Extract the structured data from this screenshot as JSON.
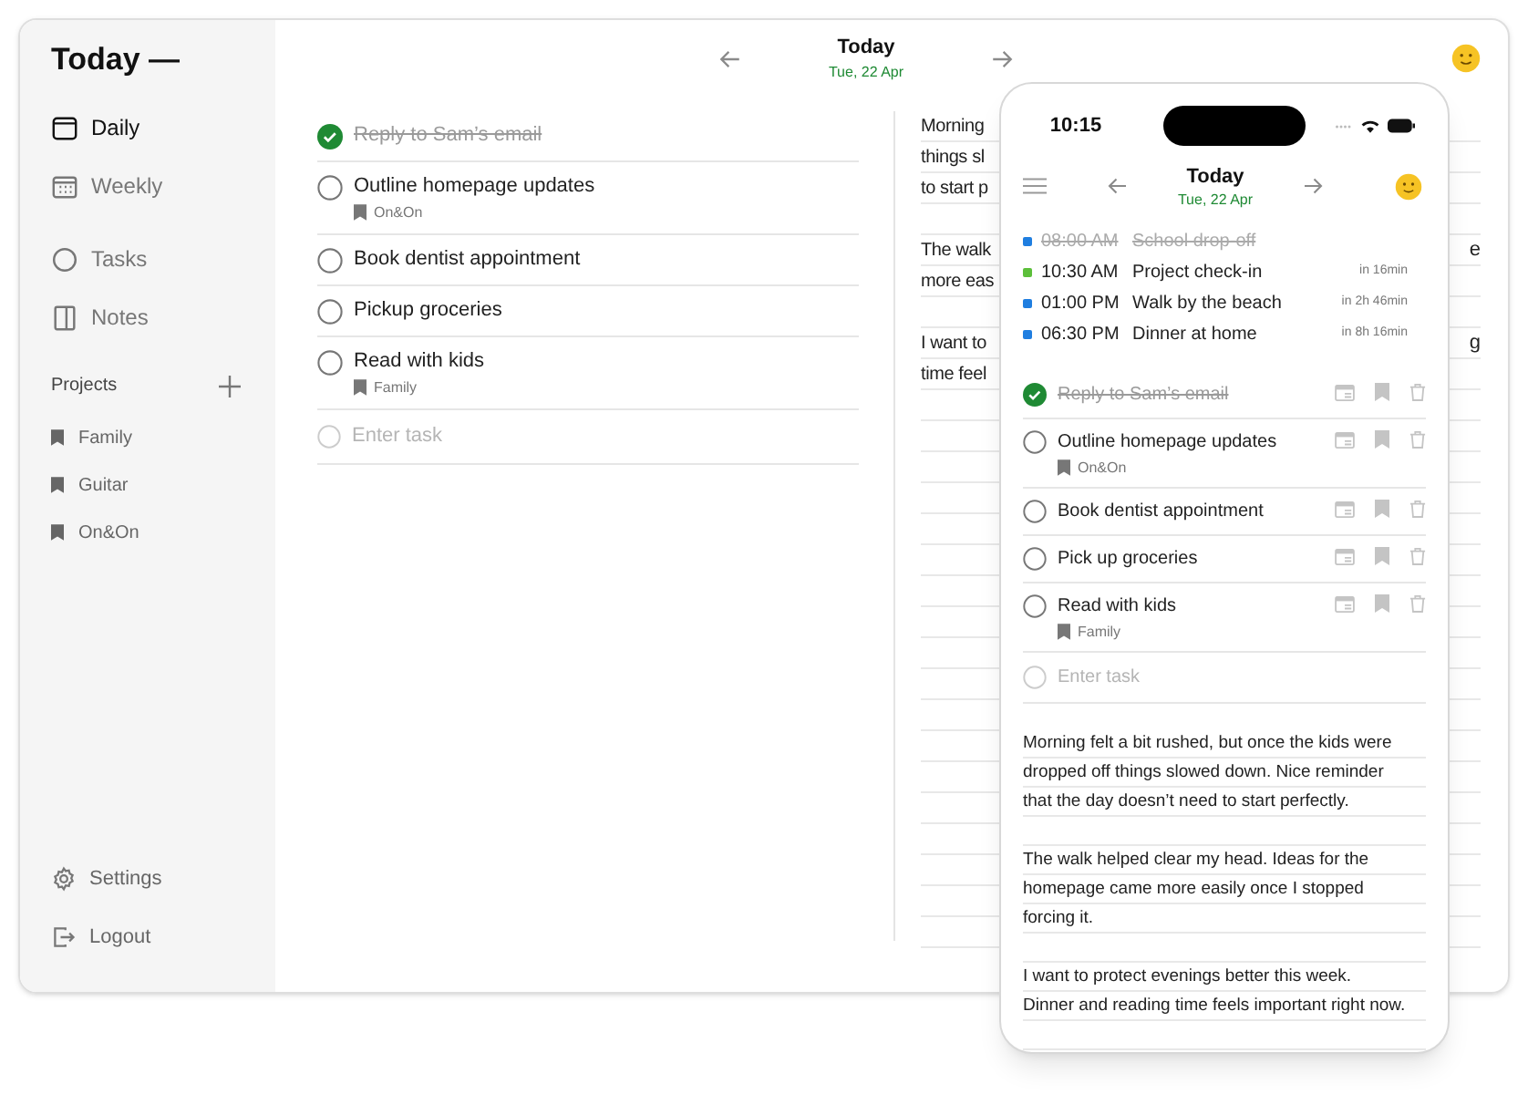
{
  "sidebar": {
    "title": "Today —",
    "nav": [
      {
        "label": "Daily",
        "kind": "daily",
        "selected": true
      },
      {
        "label": "Weekly",
        "kind": "weekly",
        "selected": false
      },
      {
        "label": "Tasks",
        "kind": "tasks",
        "selected": false
      },
      {
        "label": "Notes",
        "kind": "notes",
        "selected": false
      }
    ],
    "projects_heading": "Projects",
    "projects": [
      "Family",
      "Guitar",
      "On&On"
    ],
    "footer": [
      {
        "label": "Settings",
        "kind": "settings"
      },
      {
        "label": "Logout",
        "kind": "logout"
      }
    ]
  },
  "header": {
    "title": "Today",
    "date": "Tue, 22 Apr"
  },
  "tasks": [
    {
      "title": "Reply to Sam’s email",
      "checked": true
    },
    {
      "title": "Outline homepage updates",
      "checked": false,
      "project": "On&On"
    },
    {
      "title": "Book dentist appointment",
      "checked": false
    },
    {
      "title": "Pickup groceries",
      "checked": false
    },
    {
      "title": "Read with kids",
      "checked": false,
      "project": "Family"
    }
  ],
  "task_placeholder": "Enter task",
  "notes": [
    [
      {
        "left": "Morning"
      },
      {
        "left": "things sl"
      },
      {
        "left": "to start p"
      }
    ],
    [
      {
        "left": "The walk",
        "right": "e"
      },
      {
        "left": "more eas"
      }
    ],
    [
      {
        "left": "I want to",
        "right": "g"
      },
      {
        "left": "time feel"
      }
    ]
  ],
  "phone": {
    "time": "10:15",
    "title": "Today",
    "date": "Tue, 22 Apr",
    "events": [
      {
        "time": "08:00 AM",
        "title": "School drop-off",
        "done": true,
        "color": "#1f7ee0"
      },
      {
        "time": "10:30 AM",
        "title": "Project check-in",
        "done": false,
        "color": "#5cbf3a",
        "relative": "in 16min"
      },
      {
        "time": "01:00 PM",
        "title": "Walk by the beach",
        "done": false,
        "color": "#1f7ee0",
        "relative": "in 2h 46min"
      },
      {
        "time": "06:30 PM",
        "title": "Dinner at home",
        "done": false,
        "color": "#1f7ee0",
        "relative": "in 8h 16min"
      }
    ],
    "tasks": [
      {
        "title": "Reply to Sam’s email",
        "checked": true
      },
      {
        "title": "Outline homepage updates",
        "checked": false,
        "project": "On&On"
      },
      {
        "title": "Book dentist appointment",
        "checked": false
      },
      {
        "title": "Pick up groceries",
        "checked": false
      },
      {
        "title": "Read with kids",
        "checked": false,
        "project": "Family"
      }
    ],
    "task_placeholder": "Enter task",
    "notes": [
      [
        "Morning felt a bit rushed, but once the kids were",
        "dropped off things slowed down. Nice reminder",
        "that the day doesn’t need to start perfectly."
      ],
      [
        "The walk helped clear my head. Ideas for the",
        "homepage came more easily once I stopped",
        "forcing it."
      ],
      [
        "I want to protect evenings better this week.",
        "Dinner and reading time feels important right now."
      ]
    ]
  }
}
